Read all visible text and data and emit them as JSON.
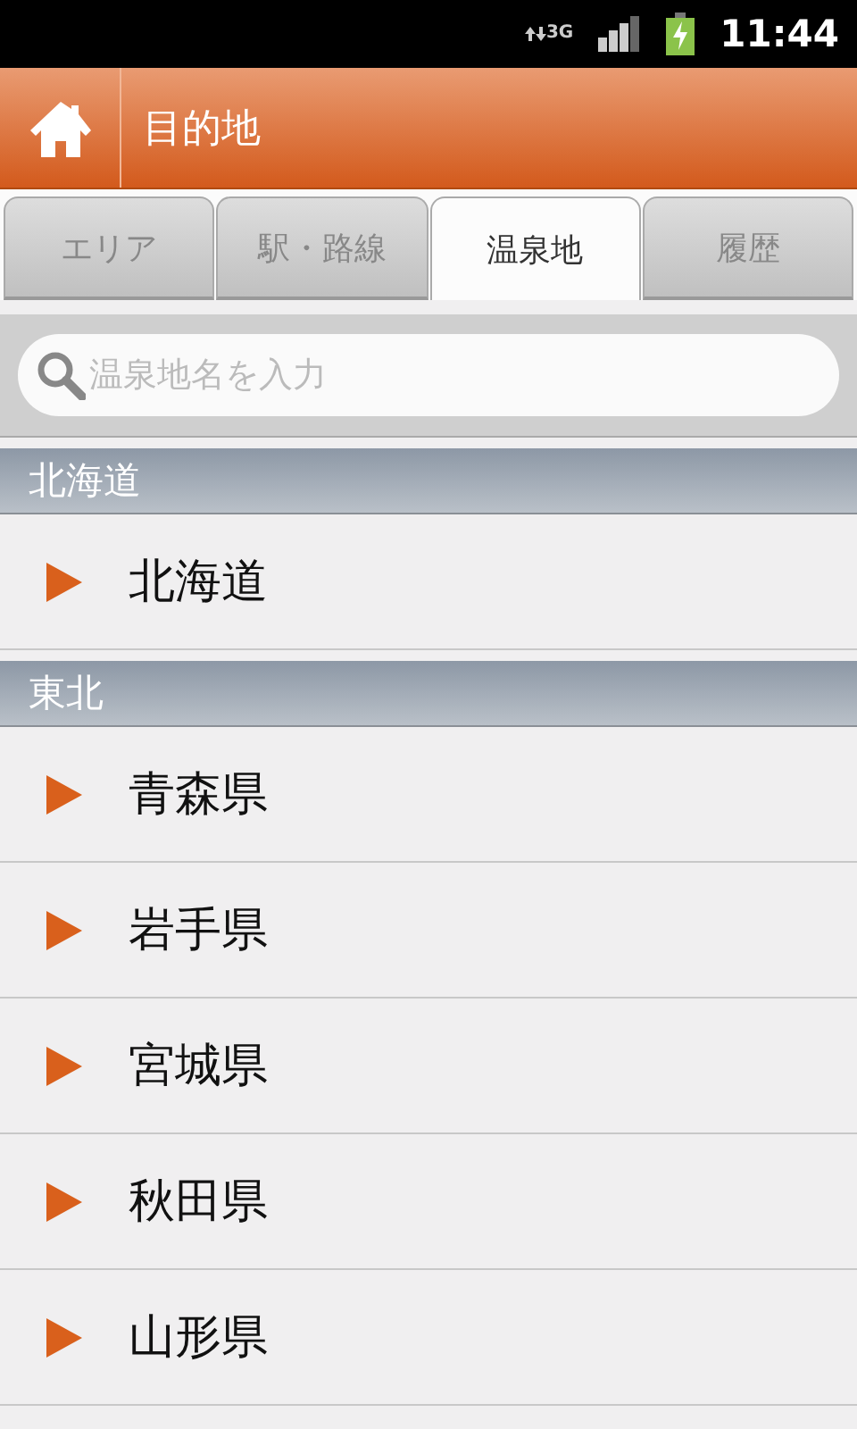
{
  "status_bar": {
    "network": "3G",
    "time": "11:44"
  },
  "header": {
    "title": "目的地"
  },
  "tabs": [
    {
      "label": "エリア",
      "selected": false
    },
    {
      "label": "駅・路線",
      "selected": false
    },
    {
      "label": "温泉地",
      "selected": true
    },
    {
      "label": "履歴",
      "selected": false
    }
  ],
  "search": {
    "placeholder": "温泉地名を入力"
  },
  "sections": [
    {
      "title": "北海道",
      "items": [
        "北海道"
      ]
    },
    {
      "title": "東北",
      "items": [
        "青森県",
        "岩手県",
        "宮城県",
        "秋田県",
        "山形県"
      ]
    }
  ]
}
